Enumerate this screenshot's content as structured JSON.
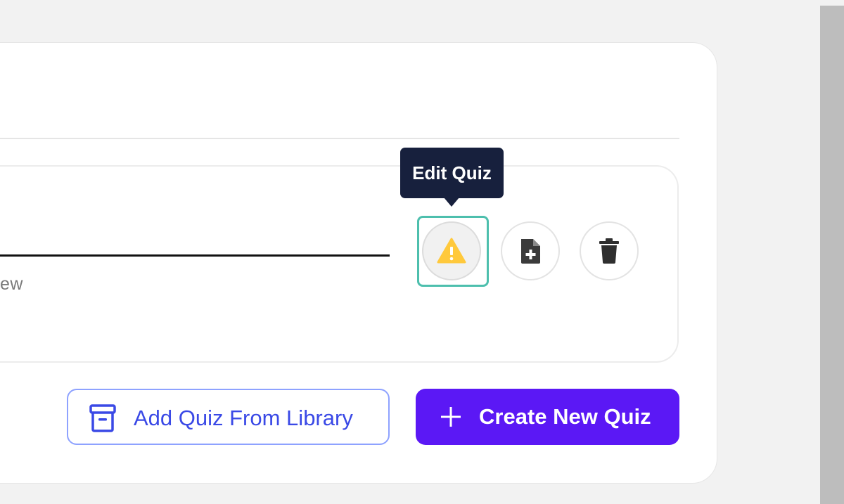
{
  "quiz": {
    "preview_partial": "ew",
    "actions": {
      "edit_tooltip": "Edit Quiz",
      "edit_icon": "warning-triangle-icon",
      "add_page_icon": "file-plus-icon",
      "delete_icon": "trash-icon"
    }
  },
  "footer": {
    "library_label": "Add Quiz From Library",
    "library_icon": "archive-box-icon",
    "create_label": "Create New Quiz",
    "create_icon": "plus-icon"
  },
  "colors": {
    "accent_purple": "#5b18f5",
    "link_blue": "#3a49e6",
    "warning_yellow": "#ffc93c",
    "tooltip_bg": "#17203d",
    "focus_teal": "#4dbfad"
  }
}
